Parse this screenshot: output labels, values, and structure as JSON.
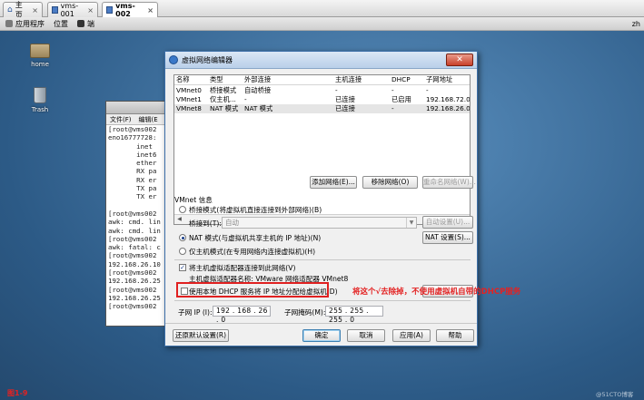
{
  "tabs": [
    {
      "label": "主页"
    },
    {
      "label": "vms-001"
    },
    {
      "label": "vms-002"
    }
  ],
  "panel": {
    "apps": "应用程序",
    "places": "位置",
    "extra": "端",
    "right": "zh"
  },
  "desktop": {
    "home_label": "home",
    "trash_label": "Trash"
  },
  "terminal": {
    "menu": [
      "文件(F)",
      "编辑(E"
    ],
    "lines": [
      "[root@vms002",
      "eno16777728:",
      "       inet",
      "       inet6",
      "       ether",
      "       RX pa",
      "       RX er",
      "       TX pa",
      "       TX er",
      "",
      "[root@vms002",
      "awk: cmd. lin",
      "awk: cmd. lin",
      "[root@vms002",
      "awk: fatal: c",
      "[root@vms002",
      "192.168.26.10",
      "[root@vms002",
      "192.168.26.25",
      "[root@vms002",
      "192.168.26.25",
      "[root@vms002"
    ]
  },
  "dialog": {
    "title": "虚拟网络编辑器",
    "close": "✕",
    "columns": [
      "名称",
      "类型",
      "外部连接",
      "主机连接",
      "DHCP",
      "子网地址"
    ],
    "rows": [
      [
        "VMnet0",
        "桥接模式",
        "自动桥接",
        "-",
        "-",
        "-"
      ],
      [
        "VMnet1",
        "仅主机...",
        "-",
        "已连接",
        "已启用",
        "192.168.72.0"
      ],
      [
        "VMnet8",
        "NAT 模式",
        "NAT 模式",
        "已连接",
        "-",
        "192.168.26.0"
      ]
    ],
    "selected_row": 2,
    "buttons": {
      "add": "添加网络(E)...",
      "remove": "移除网络(O)",
      "rename": "重命名网络(W)...",
      "auto_settings": "自动设置(U)...",
      "nat_settings": "NAT 设置(S)...",
      "restore": "还原默认设置(R)",
      "ok": "确定",
      "cancel": "取消",
      "apply": "应用(A)",
      "help": "帮助"
    },
    "vmnet_info": "VMnet 信息",
    "bridge_radio": "桥接模式(将虚拟机直接连接到外部网络)(B)",
    "bridge_to_label": "桥接到(T):",
    "bridge_to_value": "自动",
    "nat_radio": "NAT 模式(与虚拟机共享主机的 IP 地址)(N)",
    "hostonly_radio": "仅主机模式(在专用网络内连接虚拟机)(H)",
    "connect_adapter": "将主机虚拟适配器连接到此网络(V)",
    "adapter_name": "主机虚拟适配器名称: VMware 网络适配器 VMnet8",
    "dhcp_checkbox": "使用本地 DHCP 服务将 IP 地址分配给虚拟机(D)",
    "dhcp_settings": "DHCP 设置(P)...",
    "subnet_ip_label": "子网 IP (I):",
    "subnet_ip_value": "192 . 168 . 26 . 0",
    "subnet_mask_label": "子网掩码(M):",
    "subnet_mask_value": "255 . 255 . 255 . 0"
  },
  "annotation": "将这个√去除掉，不使用虚拟机自带的DHCP服务",
  "figure_label": "图1-9",
  "watermark": "@51CTO博客",
  "colors": {
    "annotation": "#e32222",
    "selection": "#e5e5e5",
    "accent": "#3c6fa8"
  }
}
